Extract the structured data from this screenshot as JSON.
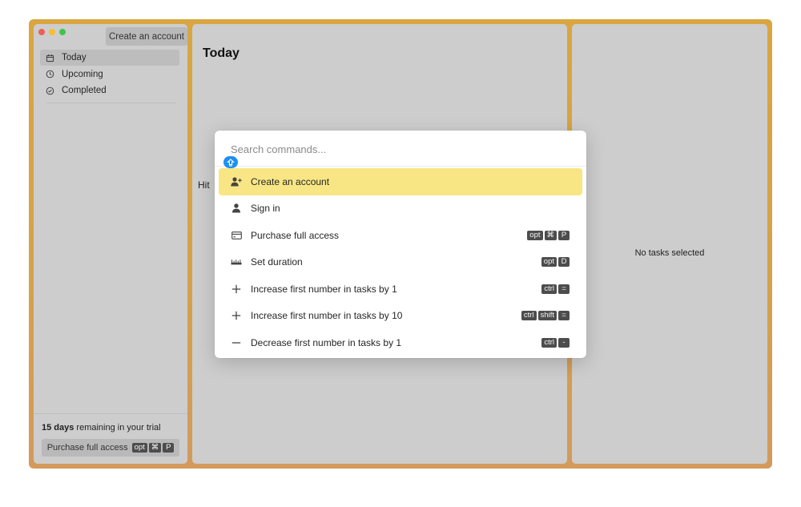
{
  "window": {
    "colors": {
      "border_top": "#d9a640",
      "border_bottom": "#d39a5c",
      "pane": "#cdcdcd"
    }
  },
  "sidebar": {
    "create_account_label": "Create an account",
    "nav": [
      {
        "label": "Today",
        "icon": "calendar-icon",
        "active": true
      },
      {
        "label": "Upcoming",
        "icon": "clock-icon",
        "active": false
      },
      {
        "label": "Completed",
        "icon": "check-circle-icon",
        "active": false
      }
    ],
    "trial": {
      "days": "15 days",
      "suffix": " remaining in your trial"
    },
    "purchase": {
      "label": "Purchase full access",
      "keys": [
        "opt",
        "⌘",
        "P"
      ]
    }
  },
  "main": {
    "title": "Today",
    "hint": "Hit"
  },
  "detail": {
    "empty_text": "No tasks selected"
  },
  "palette": {
    "search_placeholder": "Search commands...",
    "accent": "#f8e684",
    "badge_color": "#1f8ff0",
    "items": [
      {
        "label": "Create an account",
        "icon": "person-add-icon",
        "keys": [],
        "selected": true
      },
      {
        "label": "Sign in",
        "icon": "person-icon",
        "keys": [],
        "selected": false
      },
      {
        "label": "Purchase full access",
        "icon": "card-icon",
        "keys": [
          "opt",
          "⌘",
          "P"
        ],
        "selected": false
      },
      {
        "label": "Set duration",
        "icon": "ruler-icon",
        "keys": [
          "opt",
          "D"
        ],
        "selected": false
      },
      {
        "label": "Increase first number in tasks by 1",
        "icon": "plus-icon",
        "keys": [
          "ctrl",
          "="
        ],
        "selected": false
      },
      {
        "label": "Increase first number in tasks by 10",
        "icon": "plus-icon",
        "keys": [
          "ctrl",
          "shift",
          "="
        ],
        "selected": false
      },
      {
        "label": "Decrease first number in tasks by 1",
        "icon": "minus-icon",
        "keys": [
          "ctrl",
          "-"
        ],
        "selected": false
      }
    ]
  }
}
